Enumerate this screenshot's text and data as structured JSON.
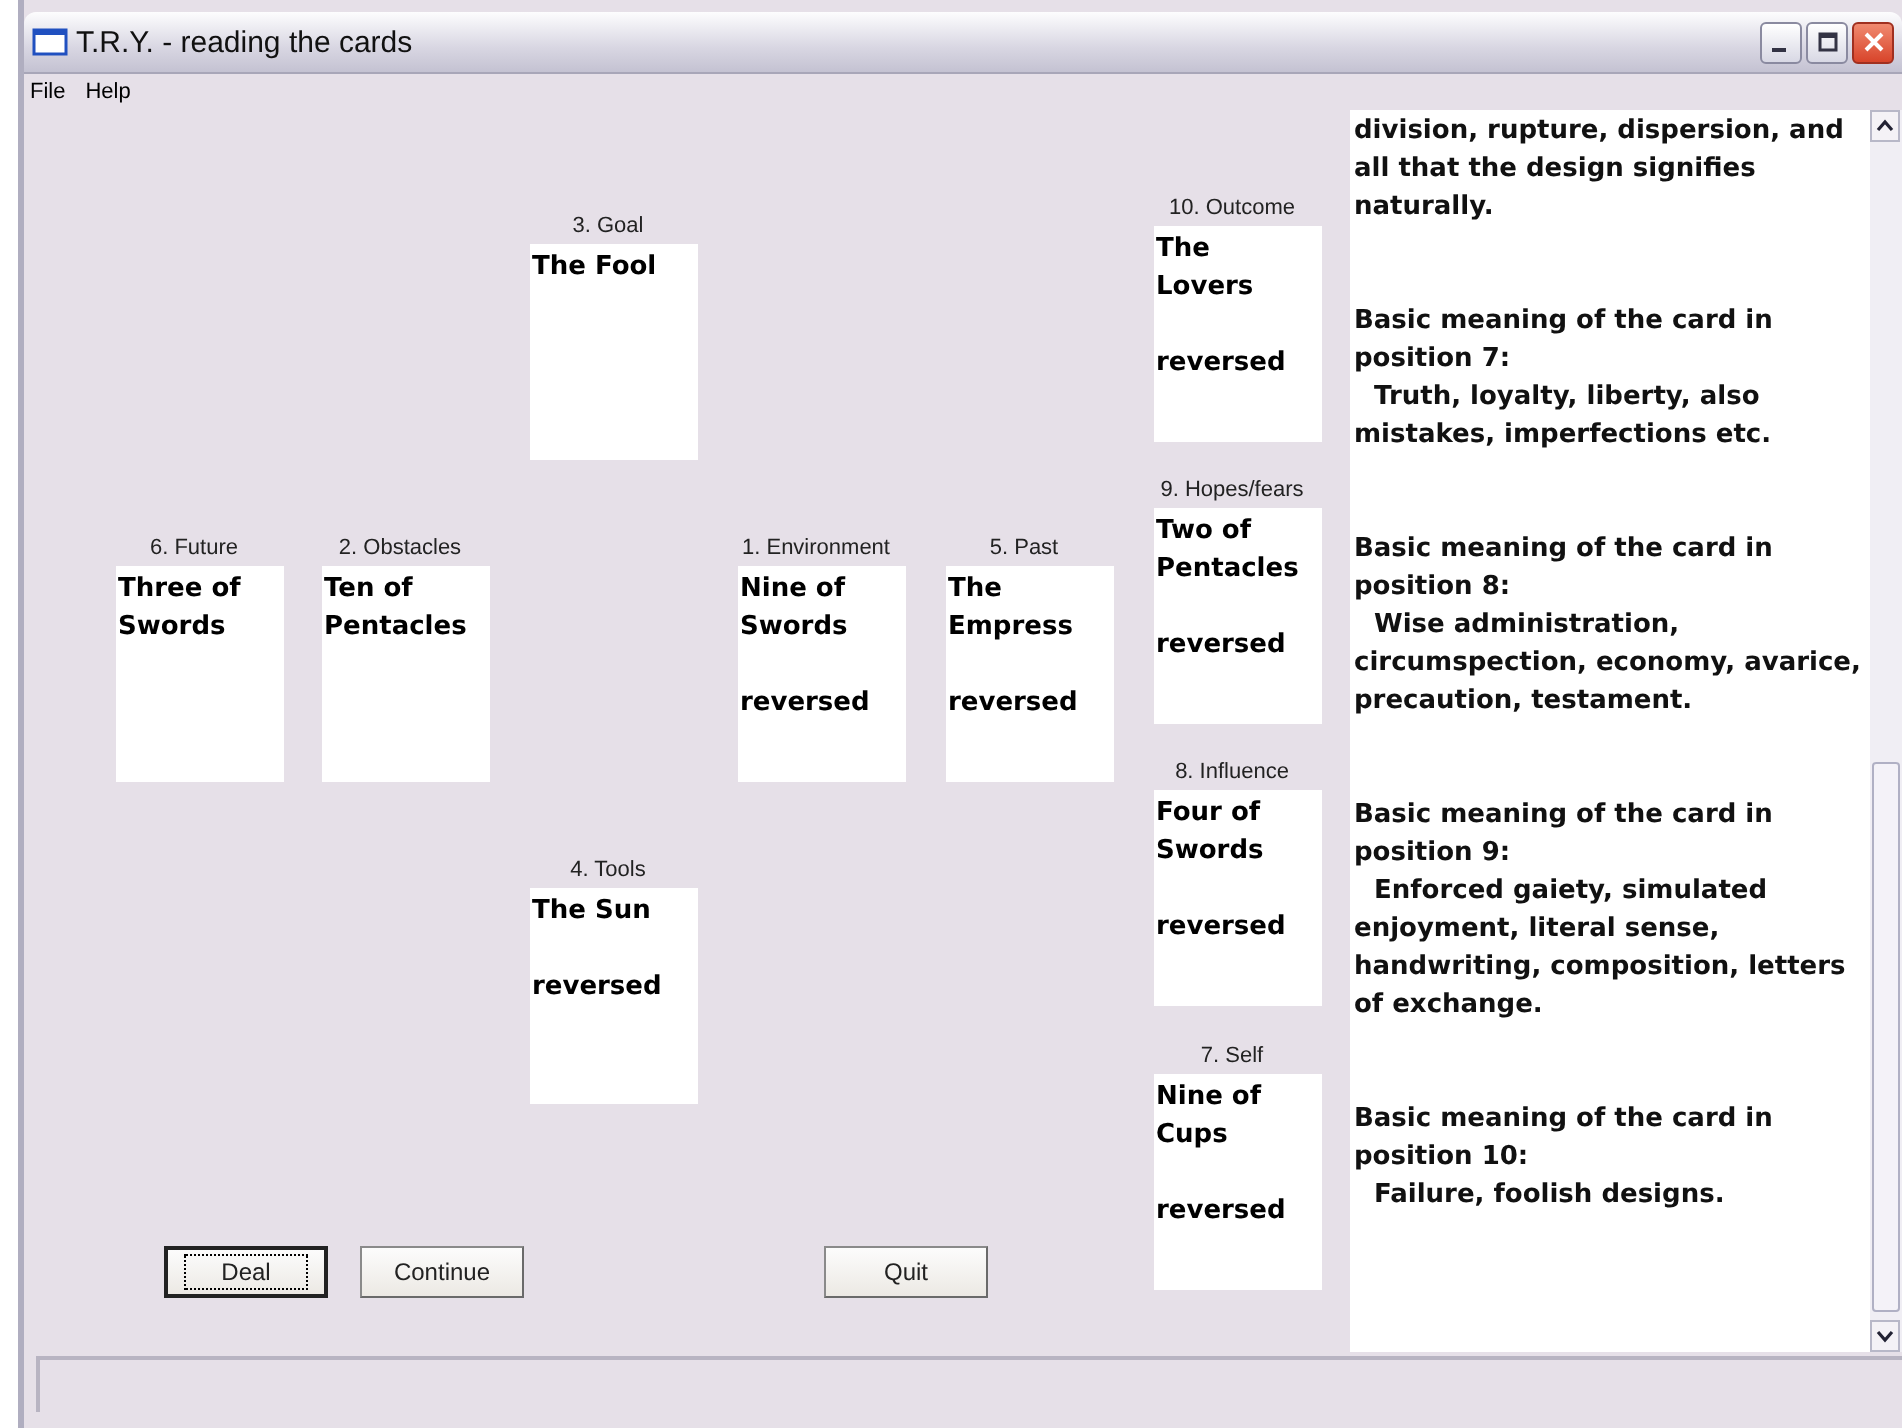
{
  "window": {
    "title": "T.R.Y. - reading the cards"
  },
  "menu": [
    "File",
    "Help"
  ],
  "cards": [
    {
      "label": "3. Goal",
      "lines": [
        "The Fool"
      ]
    },
    {
      "label": "6. Future",
      "lines": [
        "Three of",
        "Swords"
      ]
    },
    {
      "label": "2. Obstacles",
      "lines": [
        "Ten of",
        "Pentacles"
      ]
    },
    {
      "label": "1. Environment",
      "lines": [
        "Nine of",
        "Swords"
      ],
      "note": "reversed"
    },
    {
      "label": "5. Past",
      "lines": [
        "The",
        "Empress"
      ],
      "note": "reversed"
    },
    {
      "label": "4. Tools",
      "lines": [
        "The Sun"
      ],
      "note": "reversed"
    },
    {
      "label": "10. Outcome",
      "lines": [
        "The",
        "Lovers"
      ],
      "note": "reversed"
    },
    {
      "label": "9. Hopes/fears",
      "lines": [
        "Two of",
        "Pentacles"
      ],
      "note": "reversed"
    },
    {
      "label": "8. Influence",
      "lines": [
        "Four of",
        "Swords"
      ],
      "note": "reversed"
    },
    {
      "label": "7. Self",
      "lines": [
        "Nine of",
        "Cups"
      ],
      "note": "reversed"
    }
  ],
  "meanings": {
    "continued": "division, rupture, dispersion, and all that the design signifies naturally.",
    "items": [
      {
        "heading": "Basic meaning of the card in position 7:",
        "text": "Truth, loyalty, liberty, also mistakes, imperfections etc."
      },
      {
        "heading": "Basic meaning of the card in position 8:",
        "text": "Wise administration, circumspection, economy, avarice, precaution, testament."
      },
      {
        "heading": "Basic meaning of the card in position 9:",
        "text": "Enforced gaiety, simulated enjoyment, literal sense, handwriting, composition, letters of exchange."
      },
      {
        "heading": "Basic meaning of the card in position 10:",
        "text": "Failure, foolish designs."
      }
    ]
  },
  "buttons": [
    {
      "label": "Deal",
      "focused": true
    },
    {
      "label": "Continue",
      "focused": false
    },
    {
      "label": "Quit",
      "focused": false
    }
  ]
}
